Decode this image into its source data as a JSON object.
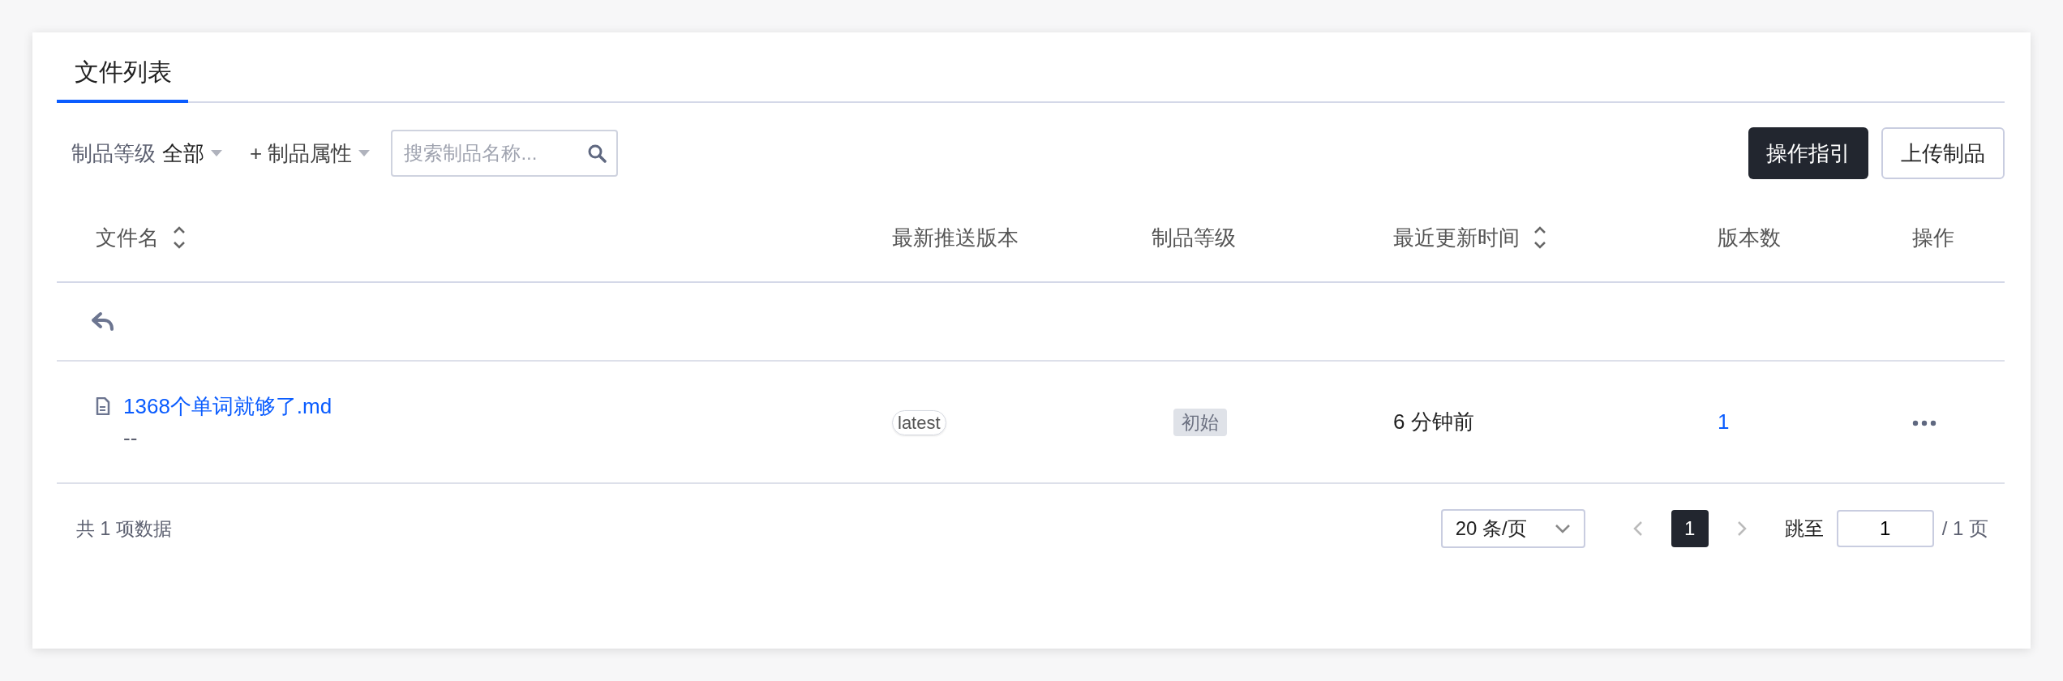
{
  "tabs": [
    {
      "label": "文件列表",
      "selected": true
    }
  ],
  "filters": {
    "grade_label": "制品等级",
    "grade_value": "全部",
    "attribute_label": "+ 制品属性",
    "search": {
      "placeholder": "搜索制品名称..."
    }
  },
  "buttons": [
    {
      "label": "操作指引",
      "kind": "primary"
    },
    {
      "label": "上传制品",
      "kind": "outline"
    }
  ],
  "table": {
    "columns": [
      {
        "label": "文件名",
        "sortable": true
      },
      {
        "label": "最新推送版本",
        "sortable": false
      },
      {
        "label": "制品等级",
        "sortable": false
      },
      {
        "label": "最近更新时间",
        "sortable": true
      },
      {
        "label": "版本数",
        "sortable": false
      },
      {
        "label": "操作",
        "sortable": false
      }
    ],
    "rows": [
      {
        "name": "1368个单词就够了.md",
        "description": "--",
        "version": "latest",
        "grade": "初始",
        "updated": "6 分钟前",
        "version_count": "1"
      }
    ]
  },
  "pagination": {
    "total": "共 1 项数据",
    "page_size": "20 条/页",
    "pages": [
      {
        "label": "1",
        "selected": true
      }
    ],
    "jump_label": "跳至",
    "jump_value": "1",
    "page_total": "/ 1 页"
  }
}
